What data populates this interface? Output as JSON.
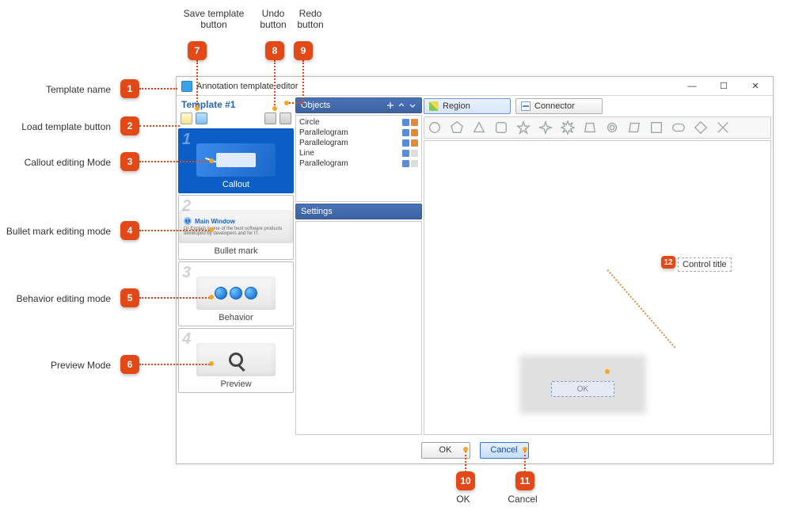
{
  "window": {
    "title": "Annotation template editor",
    "minimize_glyph": "—",
    "maximize_glyph": "☐",
    "close_glyph": "✕"
  },
  "sidebar": {
    "template_name": "Template #1",
    "modes": [
      {
        "num": "1",
        "label": "Callout"
      },
      {
        "num": "2",
        "label": "Bullet mark"
      },
      {
        "num": "3",
        "label": "Behavior"
      },
      {
        "num": "4",
        "label": "Preview"
      }
    ],
    "bullet_sample_title": "Main Window",
    "bullet_sample_text": "Dr-Explain is one of the best software products developed by developers and for IT."
  },
  "objects": {
    "header": "Objects",
    "items": [
      "Circle",
      "Parallelogram",
      "Parallelogram",
      "Line",
      "Parallelogram"
    ]
  },
  "settings": {
    "header": "Settings"
  },
  "tabs": {
    "region": "Region",
    "connector": "Connector"
  },
  "canvas": {
    "control_title": "Control title",
    "blur_btn": "OK"
  },
  "footer": {
    "ok": "OK",
    "cancel": "Cancel"
  },
  "annotations": {
    "1": "Template name",
    "2": "Load template button",
    "3": "Callout editing Mode",
    "4": "Bullet mark editing mode",
    "5": "Behavior editing mode",
    "6": "Preview Mode",
    "7": "Save template\nbutton",
    "8": "Undo\nbutton",
    "9": "Redo\nbutton",
    "10": "OK",
    "11": "Cancel",
    "12": ""
  }
}
